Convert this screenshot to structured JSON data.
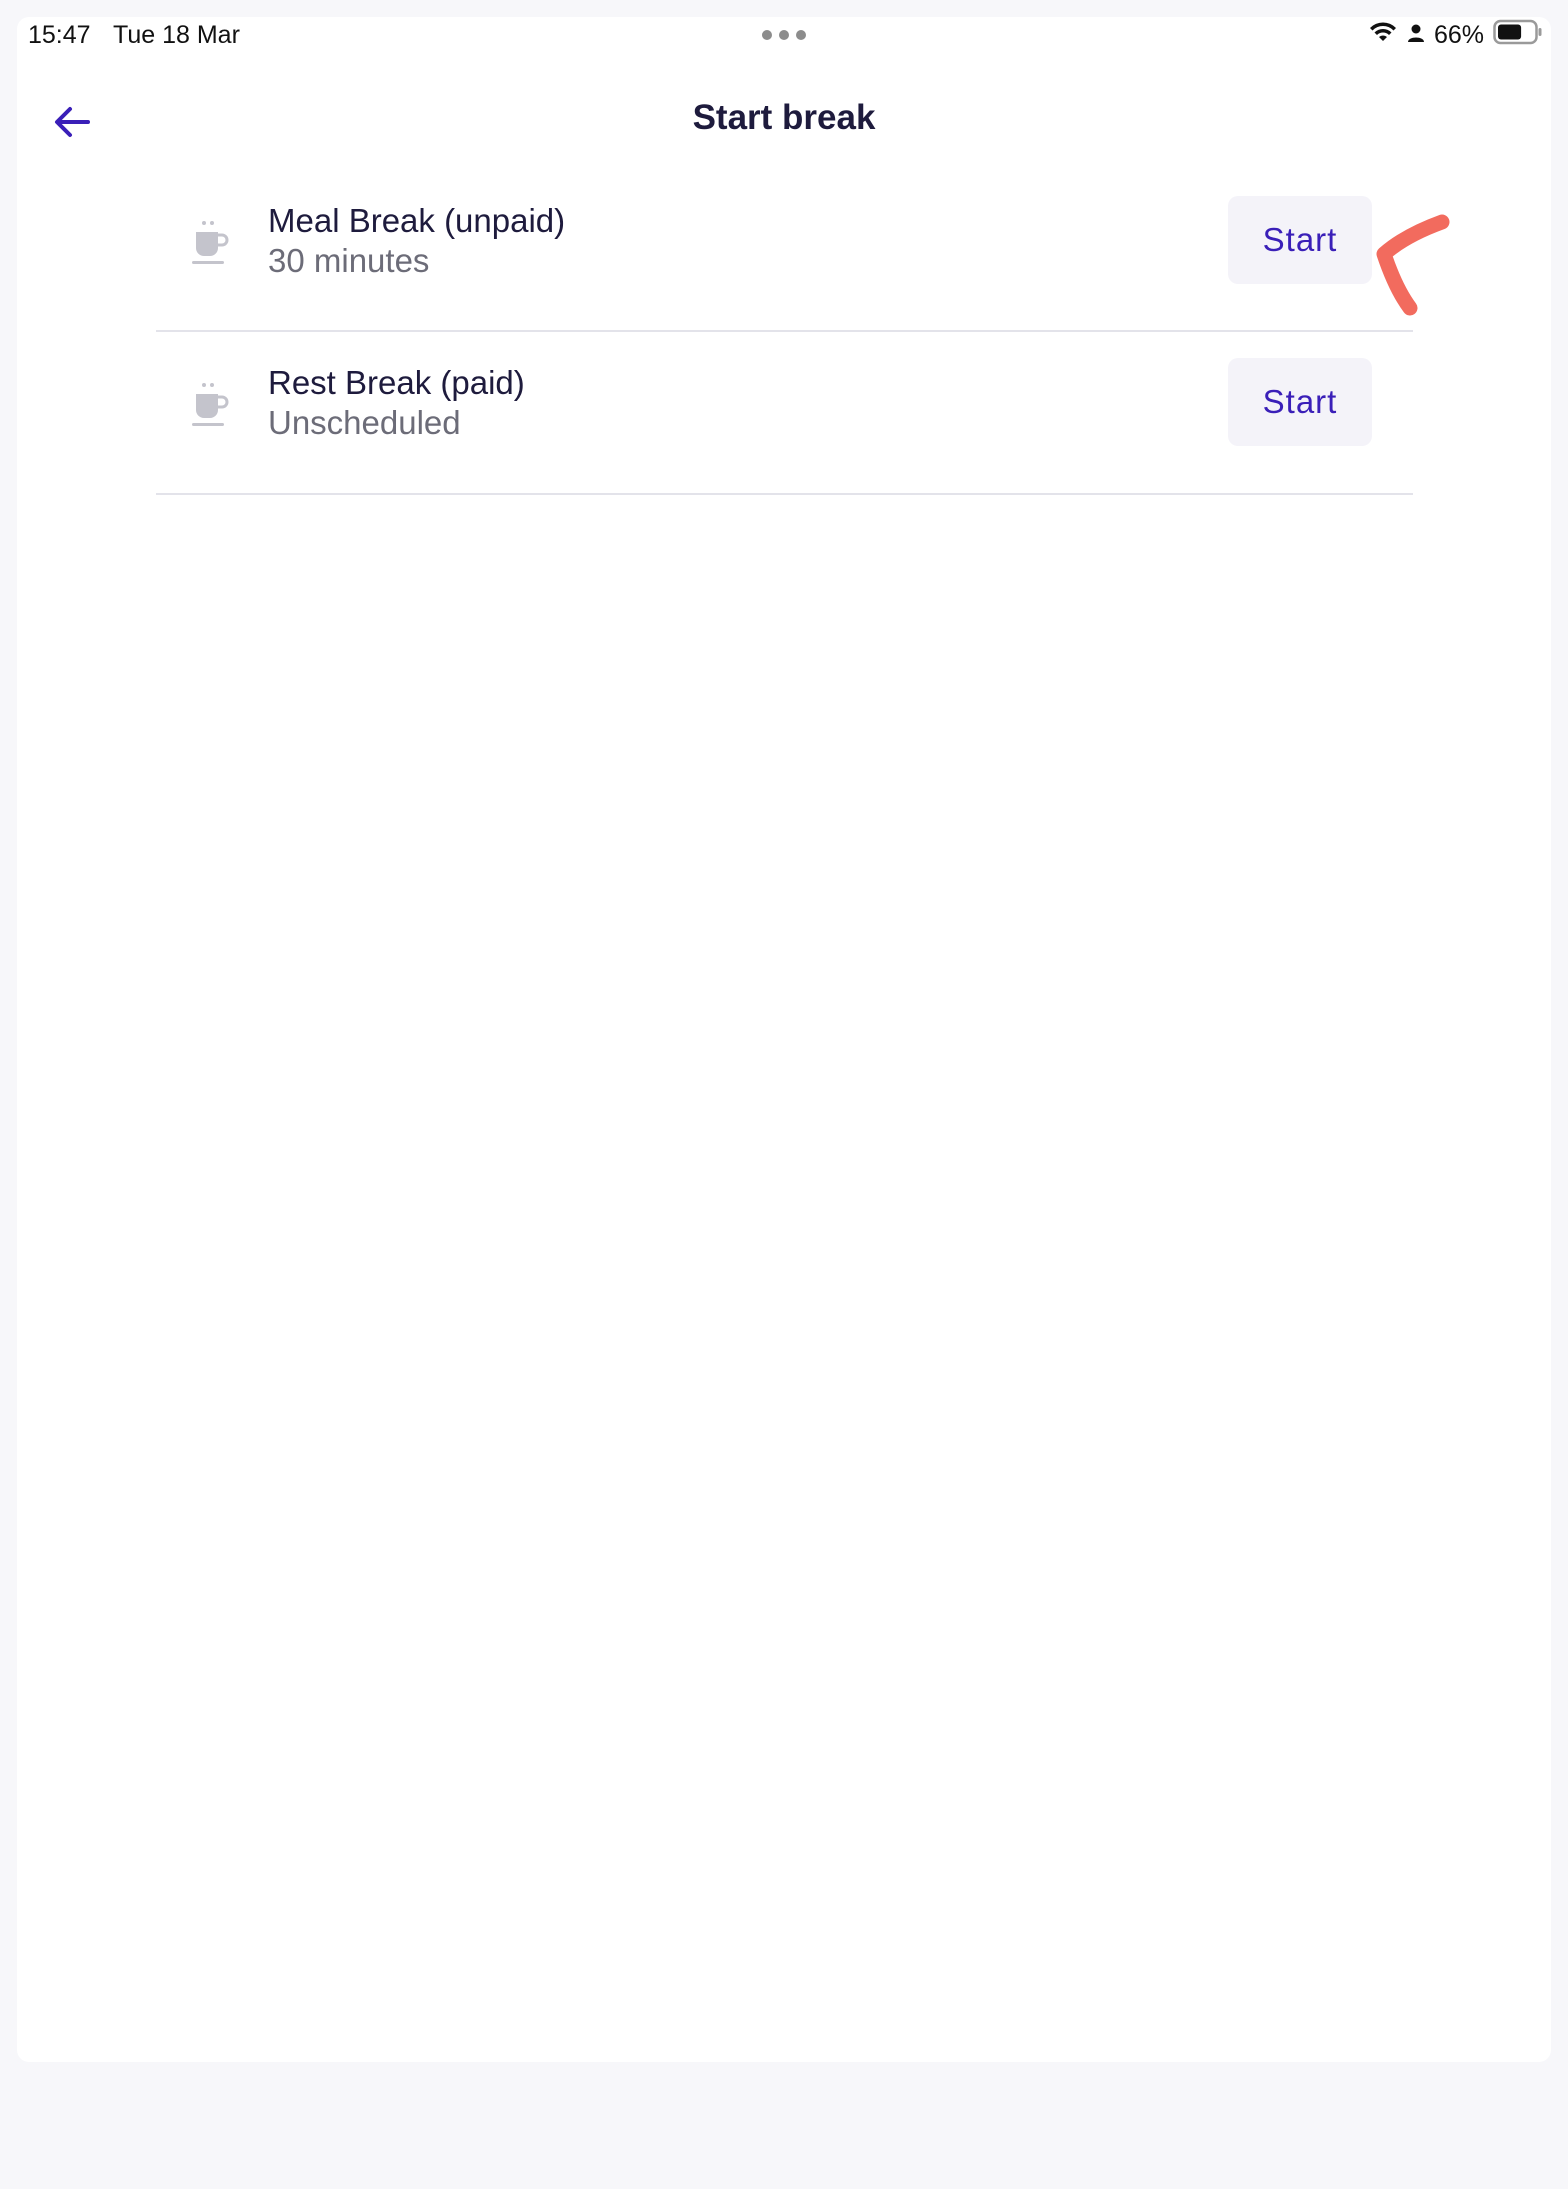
{
  "status_bar": {
    "time": "15:47",
    "date": "Tue 18 Mar",
    "battery_percent": "66%",
    "battery_level": 0.66,
    "icons": [
      "wifi-icon",
      "person-icon",
      "battery-icon"
    ]
  },
  "header": {
    "back_icon": "arrow-left-icon",
    "title": "Start break"
  },
  "breaks": [
    {
      "icon": "coffee-cup-icon",
      "name": "Meal Break (unpaid)",
      "detail": "30 minutes",
      "button_label": "Start"
    },
    {
      "icon": "coffee-cup-icon",
      "name": "Rest Break (paid)",
      "detail": "Unscheduled",
      "button_label": "Start"
    }
  ],
  "colors": {
    "accent": "#3a1fb8",
    "title": "#1e1b3d",
    "secondary_text": "#6c6c78",
    "button_bg": "#f4f3f9",
    "divider": "#e3e3ea",
    "annotation": "#f26b5e"
  }
}
